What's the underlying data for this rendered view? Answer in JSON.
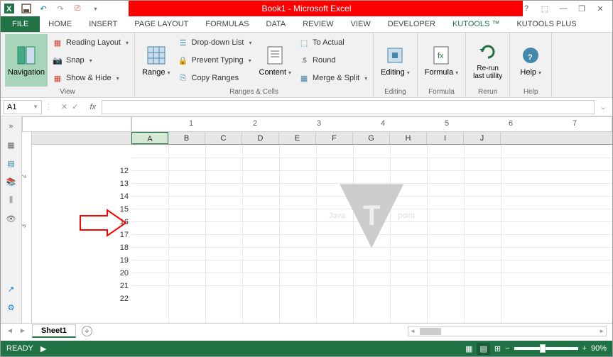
{
  "title": "Book1 - Microsoft Excel",
  "tabs": {
    "file": "FILE",
    "home": "HOME",
    "insert": "INSERT",
    "pagelayout": "PAGE LAYOUT",
    "formulas": "FORMULAS",
    "data": "DATA",
    "review": "REVIEW",
    "view": "VIEW",
    "developer": "DEVELOPER",
    "kutools": "KUTOOLS ™",
    "kutoolsplus": "KUTOOLS PLUS"
  },
  "ribbon": {
    "view": {
      "label": "View",
      "navigation": "Navigation",
      "reading": "Reading Layout",
      "snap": "Snap",
      "showhide": "Show & Hide"
    },
    "ranges": {
      "label": "Ranges & Cells",
      "range": "Range",
      "dropdown": "Drop-down List",
      "prevent": "Prevent Typing",
      "copy": "Copy Ranges",
      "content": "Content",
      "actual": "To Actual",
      "round": "Round",
      "merge": "Merge & Split"
    },
    "editing": {
      "label": "Editing",
      "btn": "Editing"
    },
    "formula": {
      "label": "Formula",
      "btn": "Formula"
    },
    "rerun": {
      "label": "Rerun",
      "btn": "Re-run\nlast utility"
    },
    "help": {
      "label": "Help",
      "btn": "Help"
    }
  },
  "namebox": "A1",
  "cols": [
    "A",
    "B",
    "C",
    "D",
    "E",
    "F",
    "G",
    "H",
    "I",
    "J"
  ],
  "rows": [
    "12",
    "13",
    "14",
    "15",
    "16",
    "17",
    "18",
    "19",
    "20",
    "21",
    "22"
  ],
  "hruler": [
    "1",
    "2",
    "3",
    "4",
    "5",
    "6",
    "7"
  ],
  "vruler": [
    "2",
    "3"
  ],
  "sheet": "Sheet1",
  "status": "READY",
  "zoom": "90%",
  "watermark": {
    "left": "Java",
    "right": "point"
  }
}
